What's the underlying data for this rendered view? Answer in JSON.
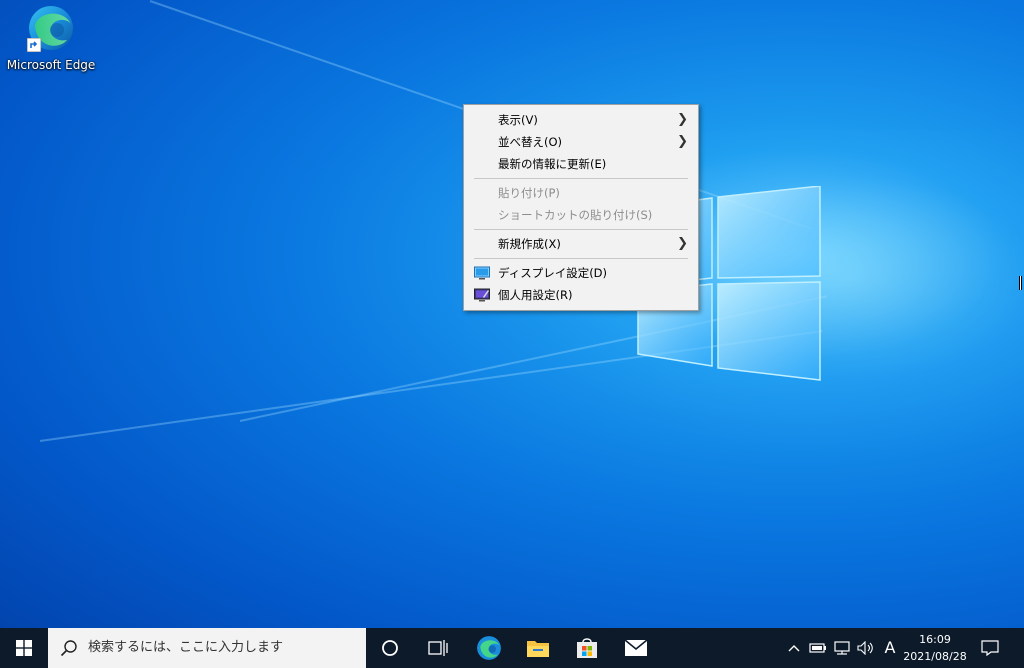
{
  "desktop": {
    "icons": [
      {
        "label": "Microsoft Edge",
        "icon": "edge-icon"
      }
    ]
  },
  "context_menu": {
    "items": [
      {
        "label": "表示(V)",
        "submenu": true,
        "disabled": false
      },
      {
        "label": "並べ替え(O)",
        "submenu": true,
        "disabled": false
      },
      {
        "label": "最新の情報に更新(E)",
        "submenu": false,
        "disabled": false
      },
      {
        "label": "貼り付け(P)",
        "submenu": false,
        "disabled": true
      },
      {
        "label": "ショートカットの貼り付け(S)",
        "submenu": false,
        "disabled": true
      },
      {
        "label": "新規作成(X)",
        "submenu": true,
        "disabled": false
      },
      {
        "label": "ディスプレイ設定(D)",
        "submenu": false,
        "disabled": false,
        "icon": "display-icon"
      },
      {
        "label": "個人用設定(R)",
        "submenu": false,
        "disabled": false,
        "icon": "personalize-icon"
      }
    ]
  },
  "taskbar": {
    "search_placeholder": "検索するには、ここに入力します",
    "apps": [
      "cortana-icon",
      "task-view-icon",
      "edge-icon",
      "file-explorer-icon",
      "store-icon",
      "mail-icon"
    ],
    "tray": {
      "ime_label": "A",
      "time": "16:09",
      "date": "2021/08/28"
    }
  },
  "colors": {
    "taskbar_bg": "#0c1a2a",
    "menu_bg": "#f2f2f2",
    "desktop_blue": "#0a78e0"
  }
}
